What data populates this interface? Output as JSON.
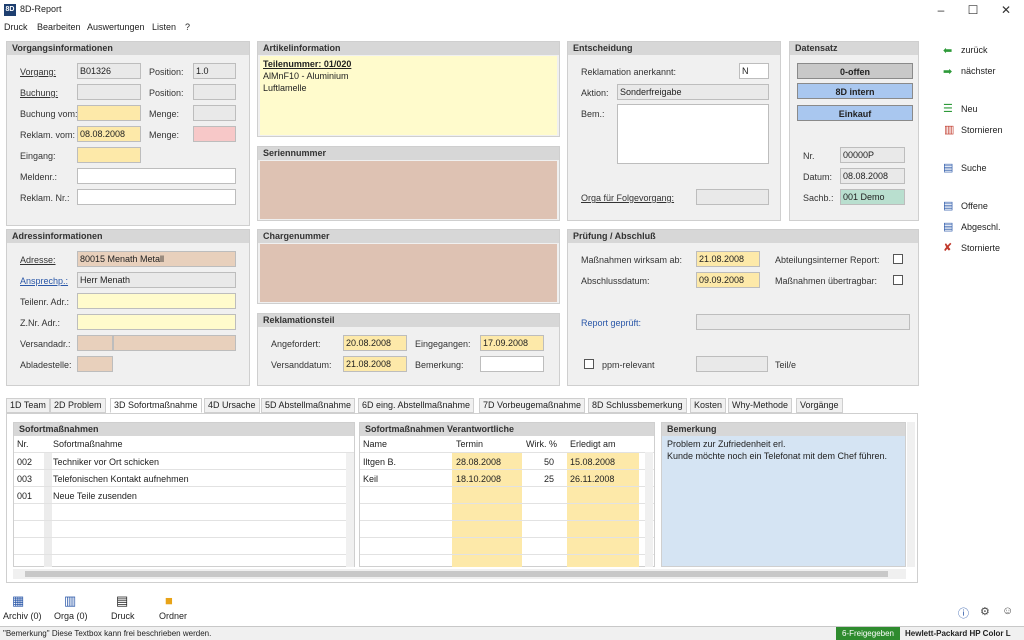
{
  "app": {
    "title": "8D-Report"
  },
  "menu": [
    "Druck",
    "Bearbeiten",
    "Auswertungen",
    "Listen",
    "?"
  ],
  "vorgang": {
    "header": "Vorgangsinformationen",
    "vorgang_label": "Vorgang:",
    "vorgang_value": "B01326",
    "position_label": "Position:",
    "position_value": "1.0",
    "buchung_label": "Buchung:",
    "position2_label": "Position:",
    "buchung_vom_label": "Buchung vom:",
    "menge_label": "Menge:",
    "reklam_vom_label": "Reklam. vom:",
    "reklam_vom_value": "08.08.2008",
    "menge2_label": "Menge:",
    "eingang_label": "Eingang:",
    "meldenr_label": "Meldenr.:",
    "reklam_nr_label": "Reklam. Nr.:"
  },
  "artikel": {
    "header": "Artikelinformation",
    "teilenummer": "Teilenummer: 01/020",
    "line2": "AlMnF10 - Aluminium",
    "line3": "Luftlamelle"
  },
  "serien": {
    "header": "Seriennummer"
  },
  "charge": {
    "header": "Chargenummer"
  },
  "entscheidung": {
    "header": "Entscheidung",
    "anerkannt_label": "Reklamation anerkannt:",
    "anerkannt_value": "N",
    "aktion_label": "Aktion:",
    "aktion_value": "Sonderfreigabe",
    "bem_label": "Bem.:",
    "orga_label": "Orga für Folgevorgang:"
  },
  "datensatz": {
    "header": "Datensatz",
    "btn_offen": "0-offen",
    "btn_intern": "8D intern",
    "btn_einkauf": "Einkauf",
    "nr_label": "Nr.",
    "nr_value": "00000P",
    "datum_label": "Datum:",
    "datum_value": "08.08.2008",
    "sachb_label": "Sachb.:",
    "sachb_value": "001  Demo"
  },
  "adresse": {
    "header": "Adressinformationen",
    "adresse_label": "Adresse:",
    "adresse_value": "80015    Menath Metall",
    "ansprech_label": "Ansprechp.:",
    "ansprech_value": "Herr Menath",
    "teilenr_label": "Teilenr. Adr.:",
    "znr_label": "Z.Nr. Adr.:",
    "versand_label": "Versandadr.:",
    "ablade_label": "Abladestelle:"
  },
  "reklamationsteil": {
    "header": "Reklamationsteil",
    "angefordert_label": "Angefordert:",
    "angefordert_value": "20.08.2008",
    "eingegangen_label": "Eingegangen:",
    "eingegangen_value": "17.09.2008",
    "versanddatum_label": "Versanddatum:",
    "versanddatum_value": "21.08.2008",
    "bemerkung_label": "Bemerkung:"
  },
  "pruefung": {
    "header": "Prüfung / Abschluß",
    "wirksam_label": "Maßnahmen wirksam ab:",
    "wirksam_value": "21.08.2008",
    "abteilung_label": "Abteilungsinterner Report:",
    "abschluss_label": "Abschlussdatum:",
    "abschluss_value": "09.09.2008",
    "uebertragbar_label": "Maßnahmen übertragbar:",
    "report_label": "Report geprüft:",
    "ppm_label": "ppm-relevant",
    "teile_label": "Teil/e"
  },
  "side": {
    "zurueck": "zurück",
    "naechster": "nächster",
    "neu": "Neu",
    "stornieren": "Stornieren",
    "suche": "Suche",
    "offene": "Offene",
    "abgeschl": "Abgeschl.",
    "stornierte": "Stornierte"
  },
  "tabs": [
    "1D Team",
    "2D Problem",
    "3D Sofortmaßnahme",
    "4D Ursache",
    "5D Abstellmaßnahme",
    "6D eing. Abstellmaßnahme",
    "7D Vorbeugemaßnahme",
    "8D Schlussbemerkung",
    "Kosten",
    "Why-Methode",
    "Vorgänge"
  ],
  "sofort": {
    "header": "Sofortmaßnahmen",
    "col_nr": "Nr.",
    "col_name": "Sofortmaßnahme",
    "rows": [
      {
        "nr": "002",
        "text": "Techniker vor Ort schicken"
      },
      {
        "nr": "003",
        "text": "Telefonischen Kontakt aufnehmen"
      },
      {
        "nr": "001",
        "text": "Neue Teile zusenden"
      }
    ]
  },
  "verantw": {
    "header": "Sofortmaßnahmen Verantwortliche",
    "col_name": "Name",
    "col_termin": "Termin",
    "col_wirk": "Wirk. %",
    "col_erledigt": "Erledigt am",
    "rows": [
      {
        "name": "Iltgen B.",
        "termin": "28.08.2008",
        "wirk": "50",
        "erledigt": "15.08.2008"
      },
      {
        "name": "Keil",
        "termin": "18.10.2008",
        "wirk": "25",
        "erledigt": "26.11.2008"
      }
    ]
  },
  "bemerkung": {
    "header": "Bemerkung",
    "line1": "Problem zur Zufriedenheit erl.",
    "line2": "Kunde möchte noch ein Telefonat mit dem Chef führen."
  },
  "bottom": {
    "archiv": "Archiv (0)",
    "orga": "Orga (0)",
    "druck": "Druck",
    "ordner": "Ordner"
  },
  "status": {
    "text": "\"Bemerkung\" Diese Textbox kann frei beschrieben werden.",
    "badge": "6-Freigegeben",
    "printer": "Hewlett-Packard HP Color L"
  },
  "colors": {
    "accent": "#2a57a8",
    "yellow": "#fde9a9",
    "tan": "#e8d0bc",
    "green_badge": "#2e8b2e"
  }
}
